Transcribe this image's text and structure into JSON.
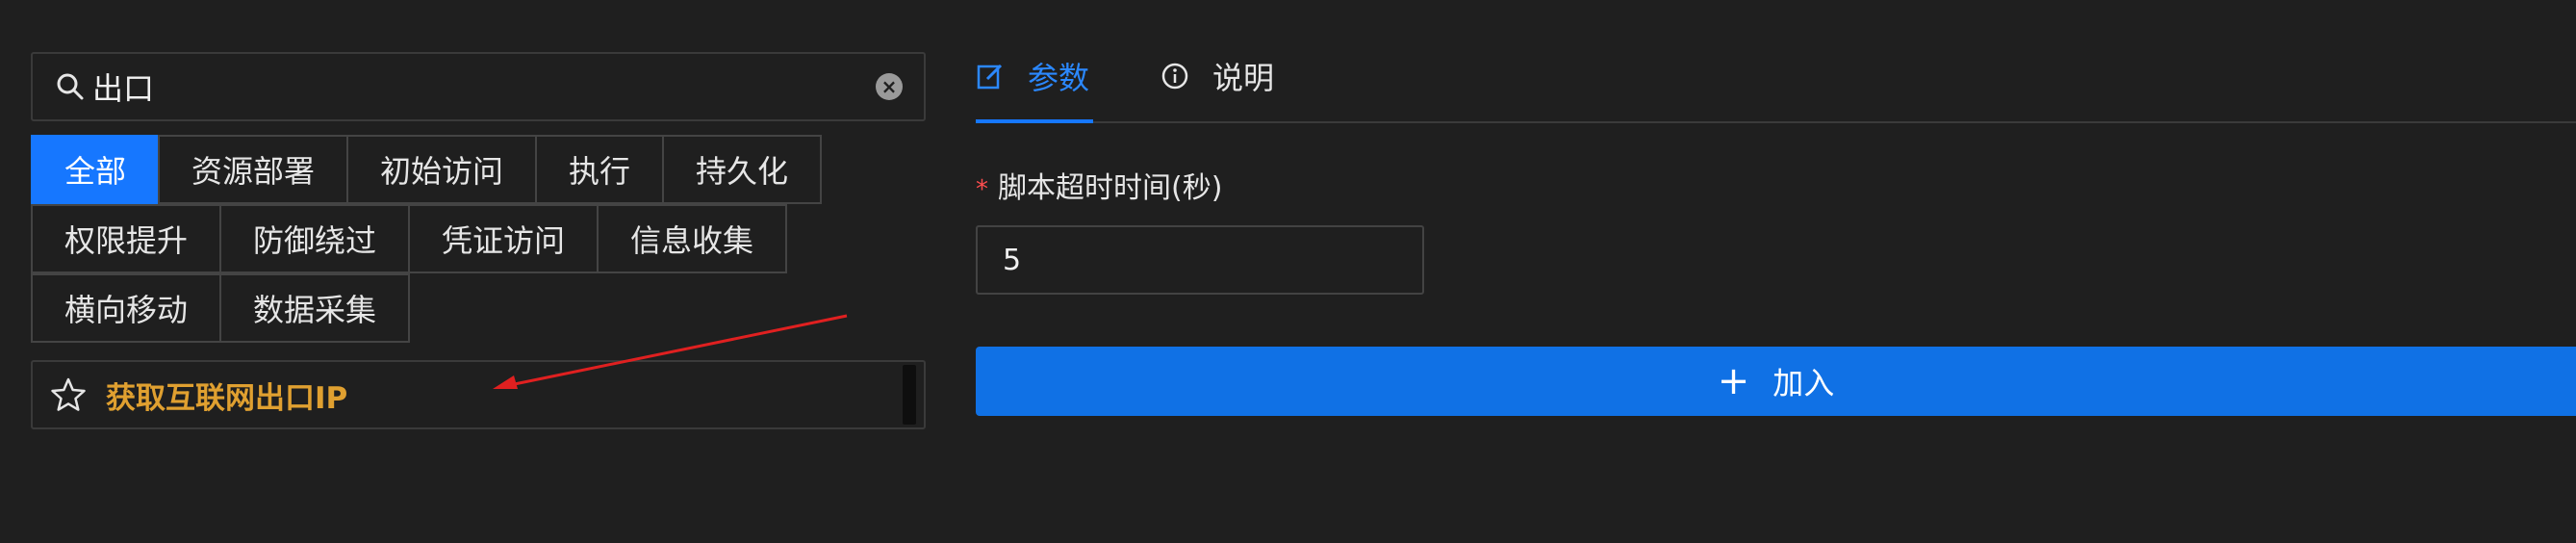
{
  "search": {
    "value": "出口",
    "clear_icon": "×"
  },
  "tags": [
    [
      "全部",
      "资源部署",
      "初始访问",
      "执行",
      "持久化"
    ],
    [
      "权限提升",
      "防御绕过",
      "凭证访问",
      "信息收集"
    ],
    [
      "横向移动",
      "数据采集"
    ]
  ],
  "active_tag": "全部",
  "result": {
    "label": "获取互联网出口IP",
    "label_color": "#e0a030"
  },
  "tabs": {
    "params": "参数",
    "desc": "说明"
  },
  "form": {
    "required_mark": "*",
    "timeout_label": "脚本超时时间(秒)",
    "timeout_value": "5",
    "add_label": "加入",
    "add_icon": "+"
  },
  "colors": {
    "accent": "#1677ff",
    "background": "#1f1f1f",
    "required": "#ff4d4f",
    "annotation_arrow": "#e02020"
  }
}
